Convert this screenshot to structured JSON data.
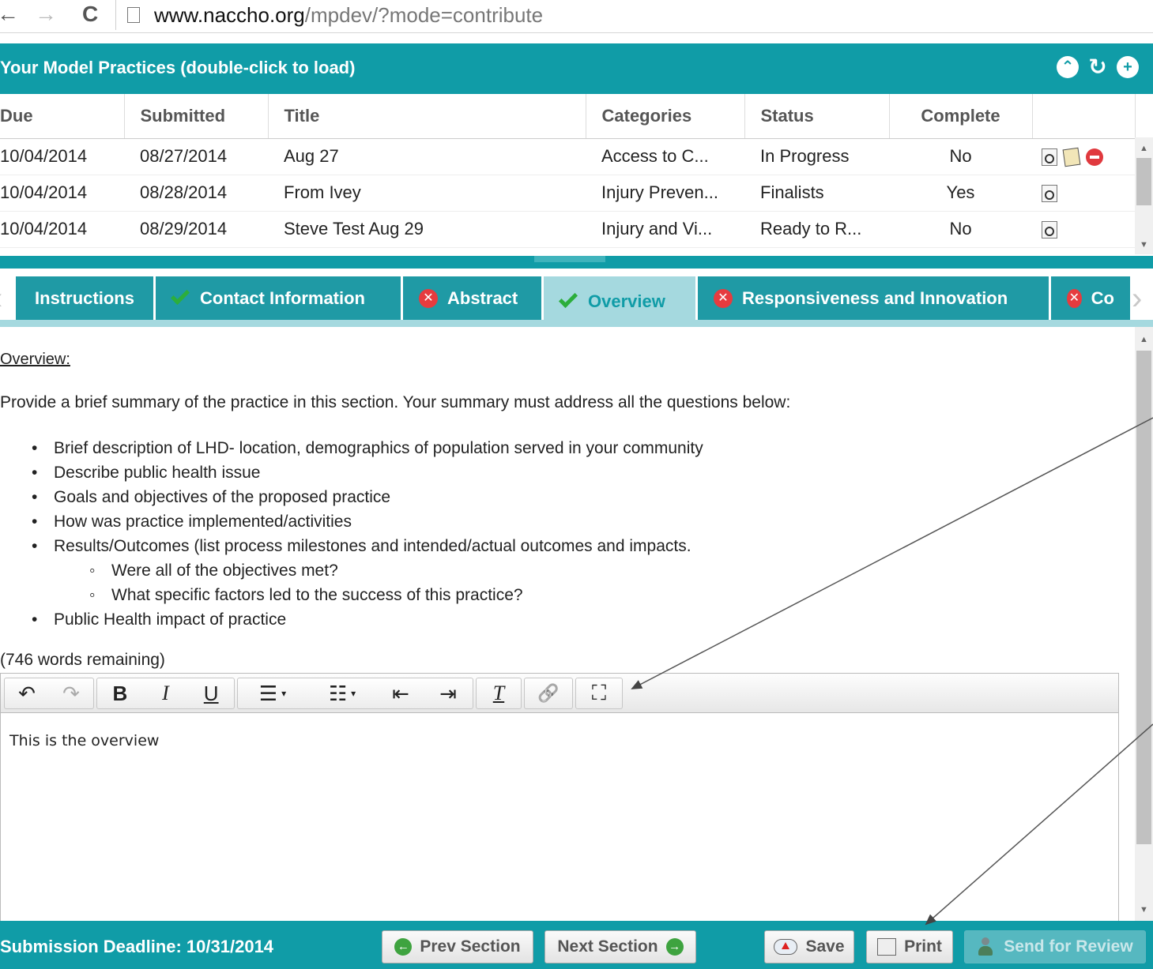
{
  "browser": {
    "back_glyph": "←",
    "forward_glyph": "→",
    "reload_glyph": "C",
    "url_host": "www.naccho.org",
    "url_path": "/mpdev/?mode=contribute"
  },
  "model_practices": {
    "title": "Your Model Practices (double-click to load)",
    "header_icons": [
      "collapse-icon",
      "refresh-icon",
      "add-icon"
    ],
    "columns": [
      "Due",
      "Submitted",
      "Title",
      "Categories",
      "Status",
      "Complete"
    ],
    "rows": [
      {
        "due": "10/04/2014",
        "submitted": "08/27/2014",
        "title": "Aug 27",
        "categories": "Access to C...",
        "status": "In Progress",
        "complete": "No",
        "actions": [
          "view-icon",
          "edit-icon",
          "delete-icon"
        ]
      },
      {
        "due": "10/04/2014",
        "submitted": "08/28/2014",
        "title": "From Ivey",
        "categories": "Injury Preven...",
        "status": "Finalists",
        "complete": "Yes",
        "actions": [
          "view-icon"
        ]
      },
      {
        "due": "10/04/2014",
        "submitted": "08/29/2014",
        "title": "Steve Test Aug 29",
        "categories": "Injury and Vi...",
        "status": "Ready to R...",
        "complete": "No",
        "actions": [
          "view-icon"
        ]
      }
    ]
  },
  "tabs": [
    {
      "label": "Instructions",
      "state": "none"
    },
    {
      "label": "Contact Information",
      "state": "complete"
    },
    {
      "label": "Abstract",
      "state": "error"
    },
    {
      "label": "Overview",
      "state": "complete",
      "active": true
    },
    {
      "label": "Responsiveness and Innovation",
      "state": "error"
    },
    {
      "label": "Co",
      "state": "error"
    }
  ],
  "overview": {
    "heading": "Overview:",
    "intro": "Provide a brief summary of the practice in this section. Your summary must address all the questions below:",
    "bullets": [
      {
        "text": "Brief description of LHD- location, demographics of population served in your community",
        "level": 1
      },
      {
        "text": "Describe public health issue",
        "level": 1
      },
      {
        "text": "Goals and objectives of the proposed practice",
        "level": 1
      },
      {
        "text": "How was practice implemented/activities",
        "level": 1
      },
      {
        "text": "Results/Outcomes (list process milestones and intended/actual outcomes and impacts.",
        "level": 1
      },
      {
        "text": "Were all of the objectives met?",
        "level": 2
      },
      {
        "text": "What specific factors led to the success of this practice?",
        "level": 2
      },
      {
        "text": "Public Health impact of practice",
        "level": 1
      }
    ],
    "words_remaining": "(746 words remaining)"
  },
  "editor": {
    "toolbar_glyphs": {
      "undo": "↶",
      "redo": "↷",
      "bold": "B",
      "italic": "I",
      "underline": "U",
      "bullet_list": "☰",
      "numbered_list": "☷",
      "outdent": "⇤",
      "indent": "⇥",
      "clear_format": "T",
      "link": "🔗",
      "fullscreen": "⛶",
      "dropdown": "▾"
    },
    "content": "This is the overview"
  },
  "footer": {
    "deadline": "Submission Deadline: 10/31/2014",
    "prev_label": "Prev Section",
    "next_label": "Next Section",
    "save_label": "Save",
    "print_label": "Print",
    "review_label": "Send for Review"
  },
  "colors": {
    "teal": "#109ca7",
    "tab_active": "#a5d9df",
    "error_red": "#e63b3f",
    "check_green": "#2cae3c"
  }
}
